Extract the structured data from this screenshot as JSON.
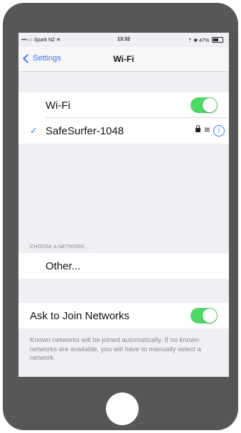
{
  "status_bar": {
    "carrier": "•••○○ Spark NZ",
    "wifi_glyph": "≋",
    "time": "13:32",
    "right_text": "⇡ ✱ 47%",
    "battery_level": 0.47
  },
  "nav": {
    "back_label": "Settings",
    "title": "Wi-Fi"
  },
  "wifi_row": {
    "label": "Wi-Fi",
    "toggle_on": true
  },
  "connected_network": {
    "name": "SafeSurfer-1048",
    "check": "✓",
    "wifi_glyph": "≋",
    "info_glyph": "i"
  },
  "choose_header": "CHOOSE A NETWORK...",
  "other_row": {
    "label": "Other..."
  },
  "ask_row": {
    "label": "Ask to Join Networks",
    "toggle_on": true
  },
  "footer_text": "Known networks will be joined automatically. If no known networks are available, you will have to manually select a network.",
  "colors": {
    "accent": "#3478f6",
    "toggle_on": "#4cd964",
    "phone_body": "#575757"
  }
}
